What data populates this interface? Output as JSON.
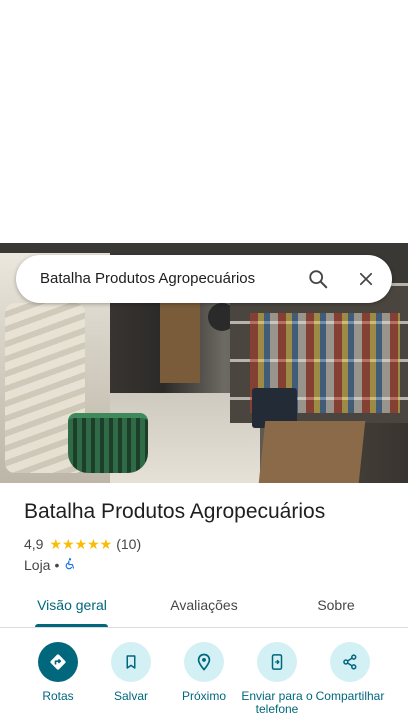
{
  "search": {
    "query": "Batalha Produtos Agropecuários"
  },
  "place": {
    "name": "Batalha Produtos Agropecuários",
    "rating": "4,9",
    "stars": "★★★★★",
    "review_count": "(10)",
    "category": "Loja",
    "separator": "•",
    "accessibility_icon": "wheelchair-icon"
  },
  "tabs": [
    {
      "label": "Visão geral",
      "active": true
    },
    {
      "label": "Avaliações",
      "active": false
    },
    {
      "label": "Sobre",
      "active": false
    }
  ],
  "actions": [
    {
      "label": "Rotas",
      "icon": "directions-icon"
    },
    {
      "label": "Salvar",
      "icon": "bookmark-icon"
    },
    {
      "label": "Próximo",
      "icon": "nearby-icon"
    },
    {
      "label": "Enviar para o telefone",
      "icon": "send-to-phone-icon"
    },
    {
      "label": "Compartilhar",
      "icon": "share-icon"
    }
  ],
  "colors": {
    "accent": "#00677d",
    "accent_light": "#d3f0f5",
    "star": "#fbbc04"
  }
}
